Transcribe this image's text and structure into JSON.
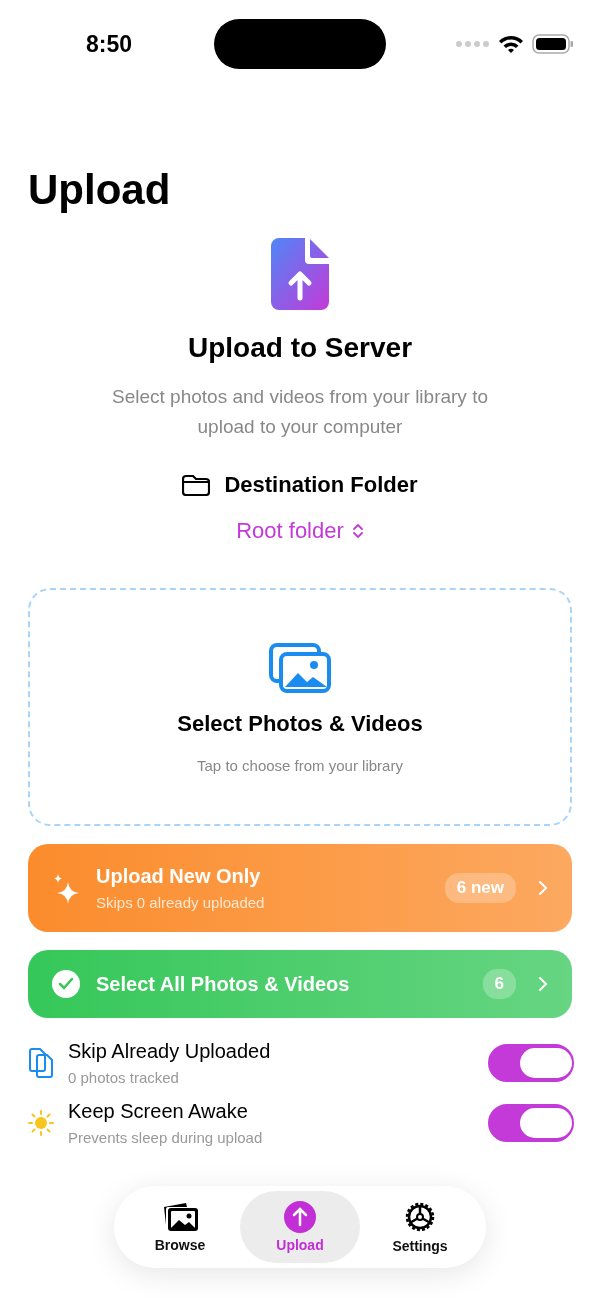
{
  "status_bar": {
    "time": "8:50"
  },
  "title": "Upload",
  "hero": {
    "heading": "Upload to Server",
    "subtitle": "Select photos and videos from your library to upload to your computer"
  },
  "destination": {
    "label": "Destination Folder",
    "value": "Root folder"
  },
  "picker": {
    "title": "Select Photos & Videos",
    "hint": "Tap to choose from your library"
  },
  "actions": [
    {
      "kind": "sparkle",
      "title": "Upload New Only",
      "subtitle": "Skips 0 already uploaded",
      "badge": "6 new",
      "color": "#fb8c2c"
    },
    {
      "kind": "check",
      "title": "Select All Photos & Videos",
      "badge": "6",
      "color": "#35c759"
    }
  ],
  "settings": [
    {
      "kind": "copies",
      "title": "Skip Already Uploaded",
      "subtitle": "0 photos tracked",
      "on": true
    },
    {
      "kind": "sun",
      "title": "Keep Screen Awake",
      "subtitle": "Prevents sleep during upload",
      "on": true
    }
  ],
  "tabs": [
    {
      "kind": "photos",
      "label": "Browse",
      "selected": false
    },
    {
      "kind": "upload",
      "label": "Upload",
      "selected": true
    },
    {
      "kind": "gear",
      "label": "Settings",
      "selected": false
    }
  ]
}
